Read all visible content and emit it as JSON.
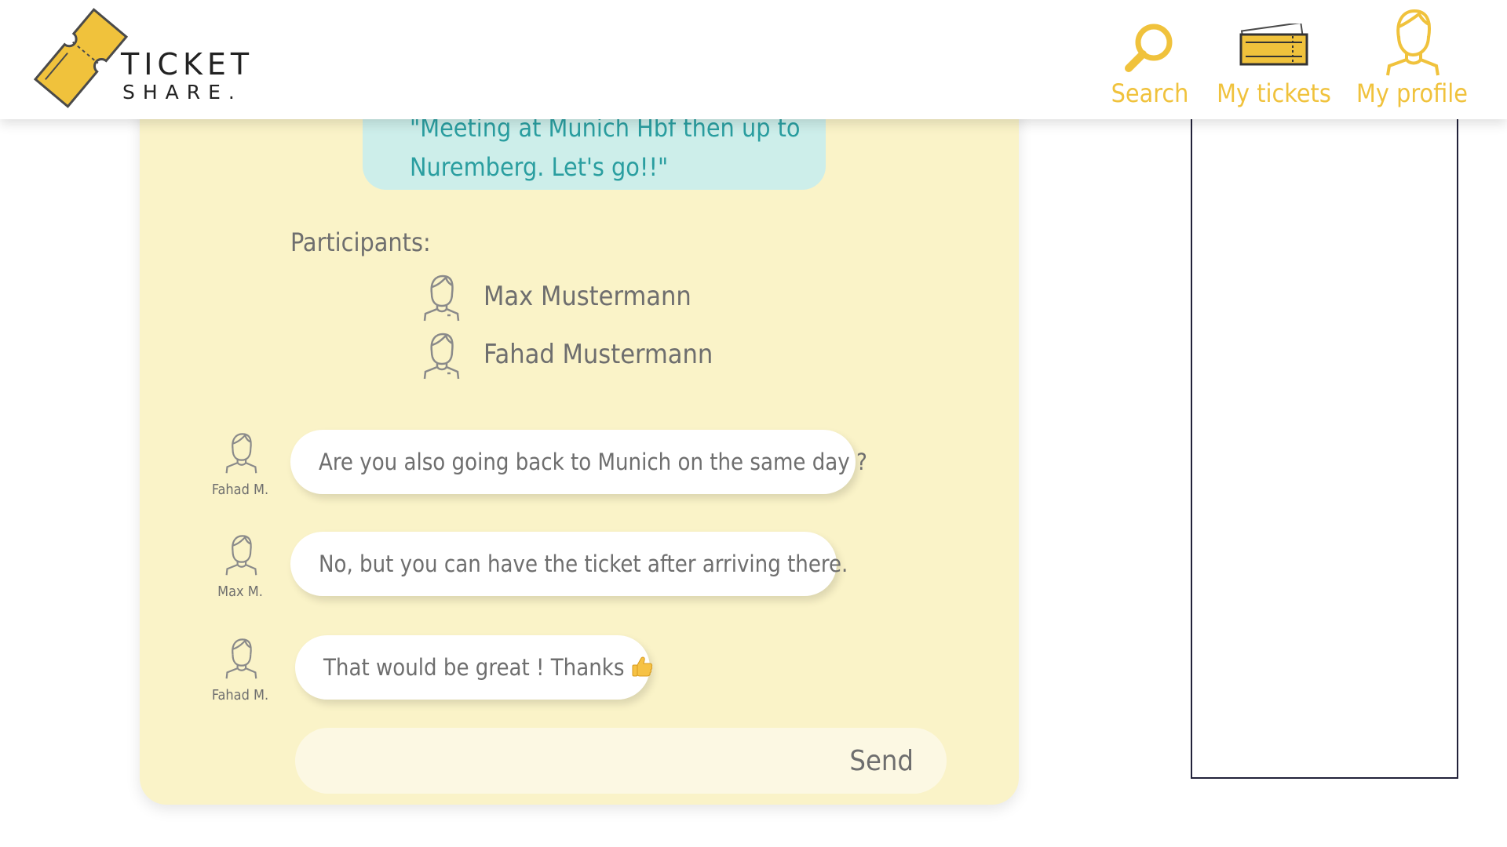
{
  "brand": {
    "name_line1": "TICKET",
    "name_line2": "SHARE."
  },
  "nav": {
    "search_label": "Search",
    "tickets_label": "My tickets",
    "profile_label": "My profile"
  },
  "chat": {
    "quote": "\"Meeting at Munich Hbf then up to Nuremberg. Let's go!!\"",
    "participants_label": "Participants:",
    "participants": [
      {
        "name": "Max Mustermann"
      },
      {
        "name": "Fahad Mustermann"
      }
    ],
    "messages": [
      {
        "sender": "Fahad M.",
        "text": "Are you also going back to Munich on the same day ?"
      },
      {
        "sender": "Max M.",
        "text": "No, but you can have the ticket after arriving there."
      },
      {
        "sender": "Fahad M.",
        "text": "That would be great ! Thanks"
      }
    ],
    "composer": {
      "value": "",
      "send_label": "Send"
    }
  },
  "colors": {
    "accent": "#f0c23c",
    "panel_bg": "#faf3c8",
    "quote_bg": "#cdeeea",
    "quote_text": "#2a9ea0",
    "text_gray": "#6e6e6e"
  },
  "icons": {
    "logo": "ticket-logo-icon",
    "search": "search-icon",
    "tickets": "tickets-icon",
    "profile": "profile-icon",
    "avatar": "user-avatar-icon",
    "emoji": "thumbs-up-emoji"
  }
}
